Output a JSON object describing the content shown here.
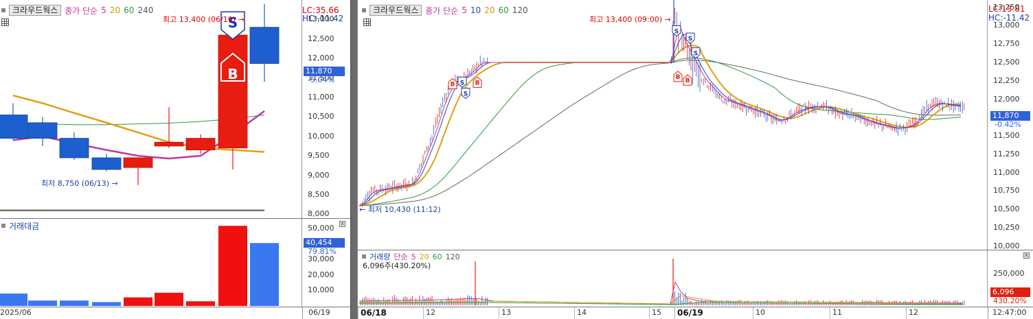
{
  "left_chart": {
    "title": "크라우드웍스",
    "ma_label": "종가 단순",
    "ma_periods": [
      "5",
      "20",
      "60",
      "240"
    ],
    "ma_colors": [
      "#c0389a",
      "#d49a00",
      "#2a9a3a",
      "#555555"
    ],
    "lc": "LC:35.66",
    "hc": "HC:-11.42",
    "price_ticks": [
      "13,000",
      "12,500",
      "12,000",
      "11,500",
      "11,000",
      "10,500",
      "10,000",
      "9,500",
      "9,000",
      "8,500",
      "8,000"
    ],
    "current_price": "11,870",
    "change_pct": "-5.04%",
    "high_label": "최고 13,400 (06/19)",
    "low_label": "최저 8,750 (06/13)",
    "sell_marker": "S",
    "buy_marker": "B",
    "volume_title": "거래대금",
    "volume_ticks": [
      "50,000",
      "40,000",
      "30,000",
      "20,000",
      "10,000"
    ],
    "volume_current": "40,454",
    "volume_pct": "79.81%",
    "date_left": "2025/06",
    "date_right": "06/19"
  },
  "right_chart": {
    "title": "크라우드웍스",
    "ma_label": "종가 단순",
    "ma_periods": [
      "5",
      "10",
      "20",
      "60",
      "120"
    ],
    "ma_colors": [
      "#c0389a",
      "#2848c8",
      "#d49a00",
      "#2a9a3a",
      "#555555"
    ],
    "lc": "LC:13.81",
    "hc": "HC:-11.42",
    "price_ticks": [
      "13,250",
      "13,000",
      "12,750",
      "12,500",
      "12,250",
      "12,000",
      "11,750",
      "11,500",
      "11,250",
      "11,000",
      "10,750",
      "10,500",
      "10,250",
      "10,000"
    ],
    "current_price": "11,870",
    "change_pct": "-0.42%",
    "high_label": "최고 13,400 (09:00)",
    "low_label": "최저 10,430 (11:12)",
    "volume_title": "거래량",
    "volume_ma_label": "단순",
    "volume_ma_periods": [
      "5",
      "20",
      "60",
      "120"
    ],
    "volume_info": "6,096주(430.20%)",
    "volume_ticks": [
      "250,000"
    ],
    "volume_current": "6,096",
    "volume_pct": "430.20%",
    "x_labels": [
      "06/18",
      "12",
      "13",
      "14",
      "15",
      "06/19",
      "10",
      "11",
      "12"
    ],
    "time_right": "12:47:00"
  },
  "chart_data": [
    {
      "type": "candlestick",
      "title": "크라우드웍스",
      "series": [
        {
          "name": "candles",
          "values": [
            {
              "o": 10550,
              "h": 10850,
              "l": 9900,
              "c": 9950
            },
            {
              "o": 10350,
              "h": 10500,
              "l": 9750,
              "c": 9950
            },
            {
              "o": 9950,
              "h": 10100,
              "l": 9400,
              "c": 9450
            },
            {
              "o": 9450,
              "h": 9550,
              "l": 9100,
              "c": 9150
            },
            {
              "o": 9200,
              "h": 9450,
              "l": 8750,
              "c": 9450
            },
            {
              "o": 9750,
              "h": 10750,
              "l": 9700,
              "c": 9850
            },
            {
              "o": 9650,
              "h": 10050,
              "l": 9550,
              "c": 9950
            },
            {
              "o": 9700,
              "h": 12600,
              "l": 9150,
              "c": 12600
            },
            {
              "o": 12800,
              "h": 13400,
              "l": 11400,
              "c": 11870
            }
          ]
        },
        {
          "name": "5",
          "values": [
            9900,
            10000,
            9820,
            9650,
            9500,
            9430,
            9500,
            10050,
            10650
          ]
        },
        {
          "name": "20",
          "values": [
            11050,
            10850,
            10600,
            10350,
            10100,
            9850,
            9700,
            9650,
            9600
          ]
        },
        {
          "name": "60",
          "values": [
            10350,
            10320,
            10300,
            10300,
            10320,
            10340,
            10380,
            10450,
            10550
          ]
        },
        {
          "name": "240",
          "values": [
            8100,
            8100,
            8100,
            8100,
            8100,
            8100,
            8100,
            8100,
            8100
          ]
        }
      ],
      "volume": [
        8000,
        3500,
        3500,
        2500,
        5500,
        8500,
        3000,
        51500,
        40454
      ],
      "ylim": [
        7900,
        13500
      ]
    },
    {
      "type": "candlestick",
      "title": "크라우드웍스",
      "x": [
        "06/18",
        "12",
        "13",
        "14",
        "15",
        "06/19",
        "10",
        "11",
        "12"
      ],
      "ylim": [
        9950,
        13350
      ]
    }
  ]
}
